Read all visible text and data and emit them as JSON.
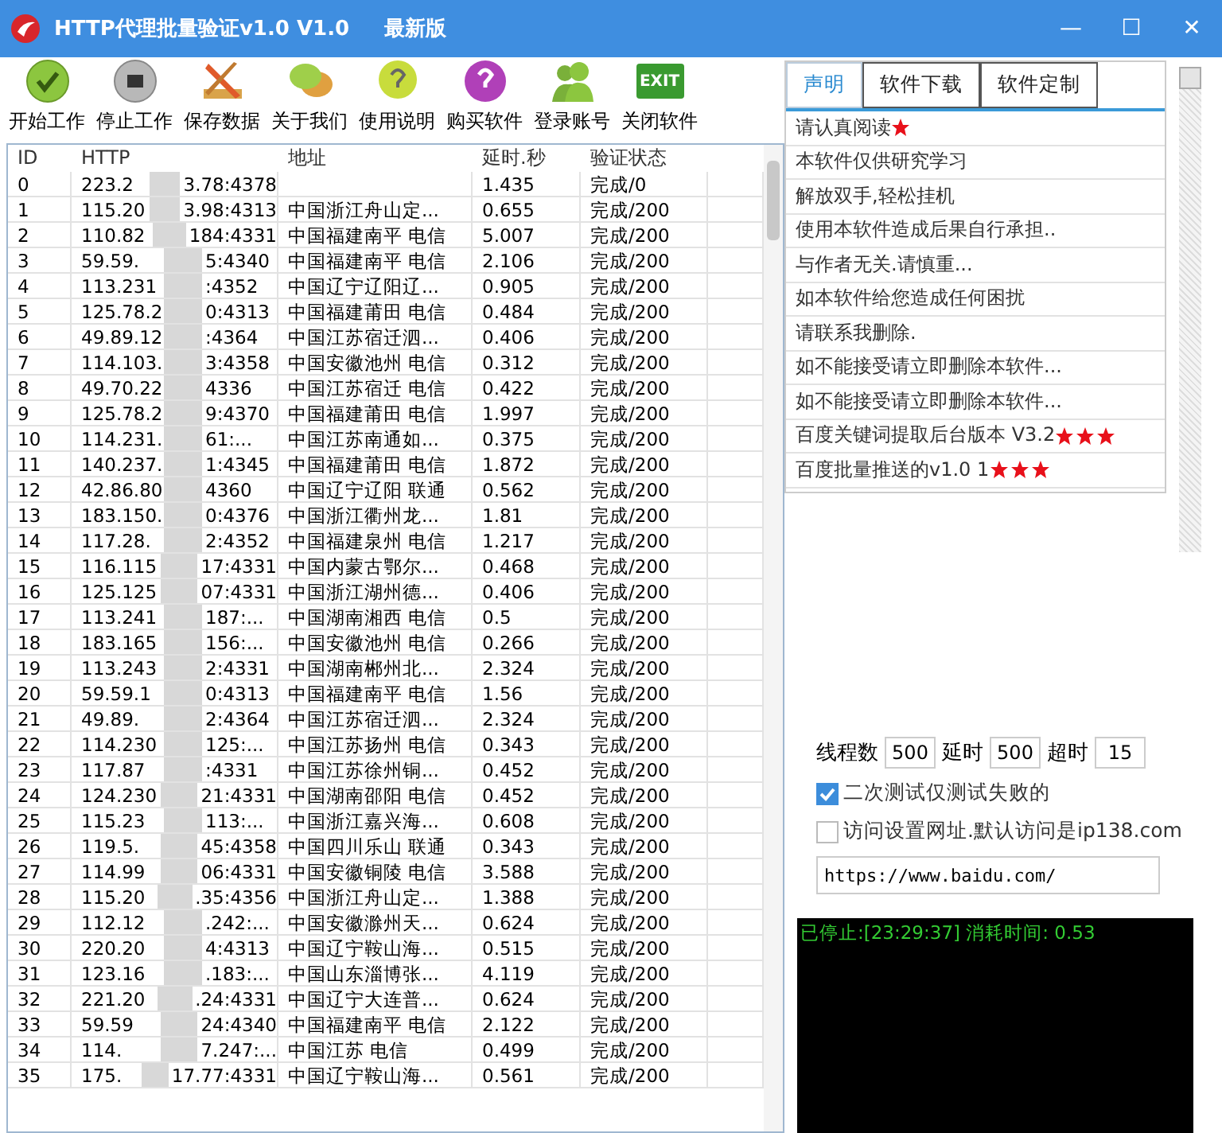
{
  "window": {
    "title": "HTTP代理批量验证v1.0 V1.0",
    "badge": "最新版",
    "controls": [
      "—",
      "☐",
      "✕"
    ]
  },
  "toolbar": [
    {
      "kind": "start",
      "label": "开始工作"
    },
    {
      "kind": "stop",
      "label": "停止工作"
    },
    {
      "kind": "save",
      "label": "保存数据"
    },
    {
      "kind": "about",
      "label": "关于我们"
    },
    {
      "kind": "help",
      "label": "使用说明"
    },
    {
      "kind": "buy",
      "label": "购买软件"
    },
    {
      "kind": "login",
      "label": "登录账号"
    },
    {
      "kind": "exit",
      "label": "关闭软件",
      "icon_text": "EXIT"
    }
  ],
  "table": {
    "columns": [
      "ID",
      "HTTP",
      "地址",
      "延时.秒",
      "验证状态"
    ],
    "rows": [
      {
        "id": "0",
        "http": [
          "223.2",
          "3.78:4378"
        ],
        "delay": "1.435",
        "status": "完成/0"
      },
      {
        "id": "1",
        "http": [
          "115.20",
          "3.98:4313"
        ],
        "addr": "中国浙江舟山定...",
        "delay": "0.655",
        "status": "完成/200"
      },
      {
        "id": "2",
        "http": [
          "110.82",
          "184:4331"
        ],
        "addr": "中国福建南平 电信",
        "delay": "5.007",
        "status": "完成/200"
      },
      {
        "id": "3",
        "http": [
          "59.59.",
          "5:4340"
        ],
        "addr": "中国福建南平 电信",
        "delay": "2.106",
        "status": "完成/200"
      },
      {
        "id": "4",
        "http": [
          "113.231",
          ":4352"
        ],
        "addr": "中国辽宁辽阳辽...",
        "delay": "0.905",
        "status": "完成/200"
      },
      {
        "id": "5",
        "http": [
          "125.78.2",
          "0:4313"
        ],
        "addr": "中国福建莆田 电信",
        "delay": "0.484",
        "status": "完成/200"
      },
      {
        "id": "6",
        "http": [
          "49.89.12",
          ":4364"
        ],
        "addr": "中国江苏宿迁泗...",
        "delay": "0.406",
        "status": "完成/200"
      },
      {
        "id": "7",
        "http": [
          "114.103.",
          "3:4358"
        ],
        "addr": "中国安徽池州 电信",
        "delay": "0.312",
        "status": "完成/200"
      },
      {
        "id": "8",
        "http": [
          "49.70.22",
          "4336"
        ],
        "addr": "中国江苏宿迁 电信",
        "delay": "0.422",
        "status": "完成/200"
      },
      {
        "id": "9",
        "http": [
          "125.78.2",
          "9:4370"
        ],
        "addr": "中国福建莆田 电信",
        "delay": "1.997",
        "status": "完成/200"
      },
      {
        "id": "10",
        "http": [
          "114.231.",
          "61:..."
        ],
        "addr": "中国江苏南通如...",
        "delay": "0.375",
        "status": "完成/200"
      },
      {
        "id": "11",
        "http": [
          "140.237.",
          "1:4345"
        ],
        "addr": "中国福建莆田 电信",
        "delay": "1.872",
        "status": "完成/200"
      },
      {
        "id": "12",
        "http": [
          "42.86.80",
          "4360"
        ],
        "addr": "中国辽宁辽阳 联通",
        "delay": "0.562",
        "status": "完成/200"
      },
      {
        "id": "13",
        "http": [
          "183.150.",
          "0:4376"
        ],
        "addr": "中国浙江衢州龙...",
        "delay": "1.81",
        "status": "完成/200"
      },
      {
        "id": "14",
        "http": [
          "117.28.",
          "2:4352"
        ],
        "addr": "中国福建泉州 电信",
        "delay": "1.217",
        "status": "完成/200"
      },
      {
        "id": "15",
        "http": [
          "116.115",
          "17:4331"
        ],
        "addr": "中国内蒙古鄂尔...",
        "delay": "0.468",
        "status": "完成/200"
      },
      {
        "id": "16",
        "http": [
          "125.125",
          "07:4331"
        ],
        "addr": "中国浙江湖州德...",
        "delay": "0.406",
        "status": "完成/200"
      },
      {
        "id": "17",
        "http": [
          "113.241",
          "187:..."
        ],
        "addr": "中国湖南湘西 电信",
        "delay": "0.5",
        "status": "完成/200"
      },
      {
        "id": "18",
        "http": [
          "183.165",
          "156:..."
        ],
        "addr": "中国安徽池州 电信",
        "delay": "0.266",
        "status": "完成/200"
      },
      {
        "id": "19",
        "http": [
          "113.243",
          "2:4331"
        ],
        "addr": "中国湖南郴州北...",
        "delay": "2.324",
        "status": "完成/200"
      },
      {
        "id": "20",
        "http": [
          "59.59.1",
          "0:4313"
        ],
        "addr": "中国福建南平 电信",
        "delay": "1.56",
        "status": "完成/200"
      },
      {
        "id": "21",
        "http": [
          "49.89.",
          "2:4364"
        ],
        "addr": "中国江苏宿迁泗...",
        "delay": "2.324",
        "status": "完成/200"
      },
      {
        "id": "22",
        "http": [
          "114.230",
          "125:..."
        ],
        "addr": "中国江苏扬州 电信",
        "delay": "0.343",
        "status": "完成/200"
      },
      {
        "id": "23",
        "http": [
          "117.87",
          ":4331"
        ],
        "addr": "中国江苏徐州铜...",
        "delay": "0.452",
        "status": "完成/200"
      },
      {
        "id": "24",
        "http": [
          "124.230",
          "21:4331"
        ],
        "addr": "中国湖南邵阳 电信",
        "delay": "0.452",
        "status": "完成/200"
      },
      {
        "id": "25",
        "http": [
          "115.23",
          "113:..."
        ],
        "addr": "中国浙江嘉兴海...",
        "delay": "0.608",
        "status": "完成/200"
      },
      {
        "id": "26",
        "http": [
          "119.5.",
          "45:4358"
        ],
        "addr": "中国四川乐山 联通",
        "delay": "0.343",
        "status": "完成/200"
      },
      {
        "id": "27",
        "http": [
          "114.99",
          "06:4331"
        ],
        "addr": "中国安徽铜陵 电信",
        "delay": "3.588",
        "status": "完成/200"
      },
      {
        "id": "28",
        "http": [
          "115.20",
          ".35:4356"
        ],
        "addr": "中国浙江舟山定...",
        "delay": "1.388",
        "status": "完成/200"
      },
      {
        "id": "29",
        "http": [
          "112.12",
          ".242:..."
        ],
        "addr": "中国安徽滁州天...",
        "delay": "0.624",
        "status": "完成/200"
      },
      {
        "id": "30",
        "http": [
          "220.20",
          "4:4313"
        ],
        "addr": "中国辽宁鞍山海...",
        "delay": "0.515",
        "status": "完成/200"
      },
      {
        "id": "31",
        "http": [
          "123.16",
          ".183:..."
        ],
        "addr": "中国山东淄博张...",
        "delay": "4.119",
        "status": "完成/200"
      },
      {
        "id": "32",
        "http": [
          "221.20",
          ".24:4331"
        ],
        "addr": "中国辽宁大连普...",
        "delay": "0.624",
        "status": "完成/200"
      },
      {
        "id": "33",
        "http": [
          "59.59",
          "24:4340"
        ],
        "addr": "中国福建南平 电信",
        "delay": "2.122",
        "status": "完成/200"
      },
      {
        "id": "34",
        "http": [
          "114.",
          "7.247:..."
        ],
        "addr": "中国江苏 电信",
        "delay": "0.499",
        "status": "完成/200"
      },
      {
        "id": "35",
        "http": [
          "175.",
          "17.77:4331"
        ],
        "addr": "中国辽宁鞍山海...",
        "delay": "0.561",
        "status": "完成/200"
      }
    ]
  },
  "tabs": [
    {
      "label": "声明",
      "selected": true
    },
    {
      "label": "软件下载",
      "selected": false
    },
    {
      "label": "软件定制",
      "selected": false
    }
  ],
  "notice": [
    {
      "text": "请认真阅读",
      "starred": true
    },
    {
      "text": "本软件仅供研究学习"
    },
    {
      "text": "解放双手,轻松挂机"
    },
    {
      "text": "使用本软件造成后果自行承担.."
    },
    {
      "text": "与作者无关.请慎重..."
    },
    {
      "text": "如本软件给您造成任何困扰"
    },
    {
      "text": "请联系我删除."
    },
    {
      "text": "如不能接受请立即删除本软件..."
    },
    {
      "text": "如不能接受请立即删除本软件..."
    },
    {
      "text": "百度关键词提取后台版本 V3.2",
      "stars": 3
    },
    {
      "text": "百度批量推送的v1.0 1",
      "stars": 3
    }
  ],
  "settings": {
    "fields": [
      {
        "label": "线程数",
        "value": "500"
      },
      {
        "label": "延时",
        "value": "500"
      },
      {
        "label": "超时",
        "value": "15"
      }
    ],
    "options": [
      {
        "label": "二次测试仅测试失败的",
        "checked": true
      },
      {
        "label": "访问设置网址.默认访问是ip138.com",
        "checked": false
      }
    ],
    "url": "https://www.baidu.com/"
  },
  "console": {
    "lines": [
      "已停止:[23:29:37] 消耗时间: 0.53"
    ]
  }
}
